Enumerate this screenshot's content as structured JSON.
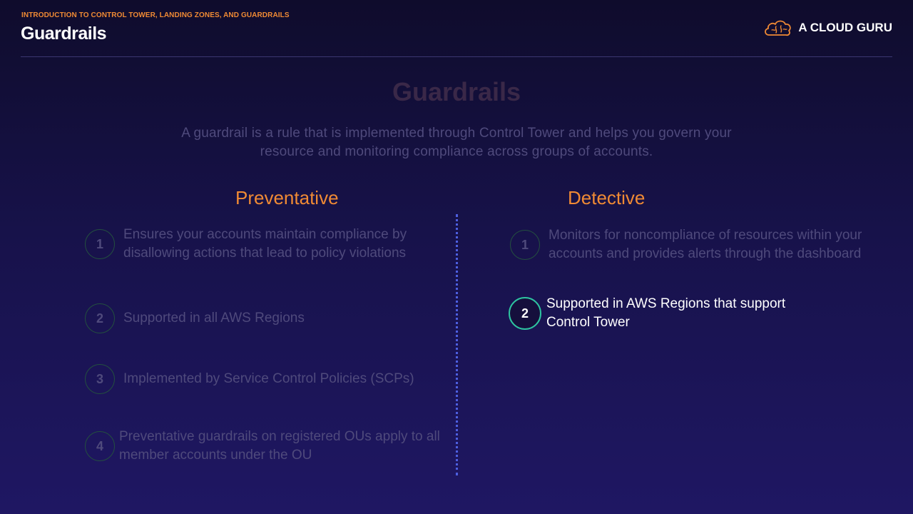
{
  "header": {
    "kicker": "INTRODUCTION TO CONTROL TOWER, LANDING ZONES, AND GUARDRAILS",
    "title": "Guardrails",
    "brand": "A CLOUD GURU",
    "brand_icon": "cloud-brain-icon"
  },
  "slide": {
    "title": "Guardrails",
    "intro": "A guardrail is a rule that is implemented through Control Tower and helps you govern your resource and monitoring compliance across groups of accounts."
  },
  "preventative": {
    "heading": "Preventative",
    "items": [
      {
        "number": "1",
        "text": "Ensures your accounts maintain compliance by disallowing actions that lead to policy violations"
      },
      {
        "number": "2",
        "text": "Supported in all AWS Regions"
      },
      {
        "number": "3",
        "text": "Implemented by Service Control Policies (SCPs)"
      },
      {
        "number": "4",
        "text": "Preventative guardrails on registered OUs apply to all member accounts under the OU"
      }
    ]
  },
  "detective": {
    "heading": "Detective",
    "items": [
      {
        "number": "1",
        "text": "Monitors for noncompliance of resources within your accounts and provides alerts through the dashboard"
      },
      {
        "number": "2",
        "text": "Supported in AWS Regions that support Control Tower"
      }
    ]
  },
  "colors": {
    "accent": "#f08a34",
    "highlight_ring": "#2ec4a0",
    "divider": "#4d5fe0",
    "dimmed_text": "#4f4a7c"
  }
}
